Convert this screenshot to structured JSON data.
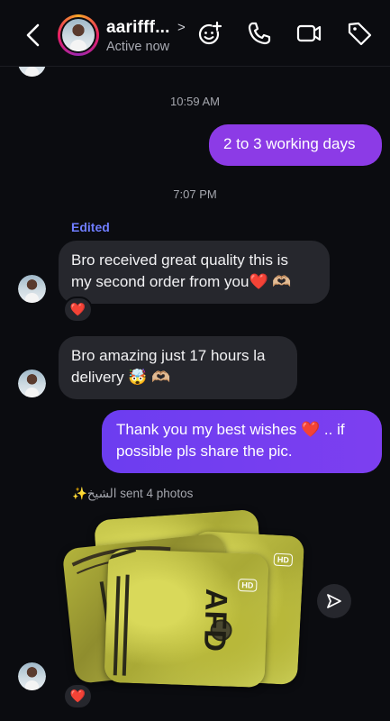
{
  "header": {
    "contact_name": "aarifff...",
    "status": "Active now"
  },
  "thread": {
    "time_1": "10:59 AM",
    "out_msg_1": "2 to 3 working days",
    "time_2": "7:07 PM",
    "edited_label": "Edited",
    "in_msg_1_line1": "Bro received great quality this is",
    "in_msg_1_line2": "my second order from you❤️ 🫶🏼",
    "in_msg_1_reaction": "❤️",
    "in_msg_2_line1": "Bro amazing just 17 hours la",
    "in_msg_2_line2": "delivery 🤯 🫶🏼",
    "out_msg_2_line1": "Thank you my best wishes ❤️ .. if",
    "out_msg_2_line2": "possible pls share the pic.",
    "photos_caption": "✨الشيخ sent 4 photos",
    "hd_badge_1": "HD",
    "hd_badge_2": "HD",
    "photo_reaction": "❤️"
  },
  "colors": {
    "background": "#0b0c10",
    "incoming_bubble": "#26272d",
    "outgoing_bubble": "#7d3ff0",
    "edited": "#6f7dff"
  },
  "icons": [
    "back-arrow-icon",
    "chevron-right-icon",
    "add-emoji-icon",
    "phone-icon",
    "video-camera-icon",
    "tag-icon",
    "share-send-icon",
    "heart-icon"
  ]
}
